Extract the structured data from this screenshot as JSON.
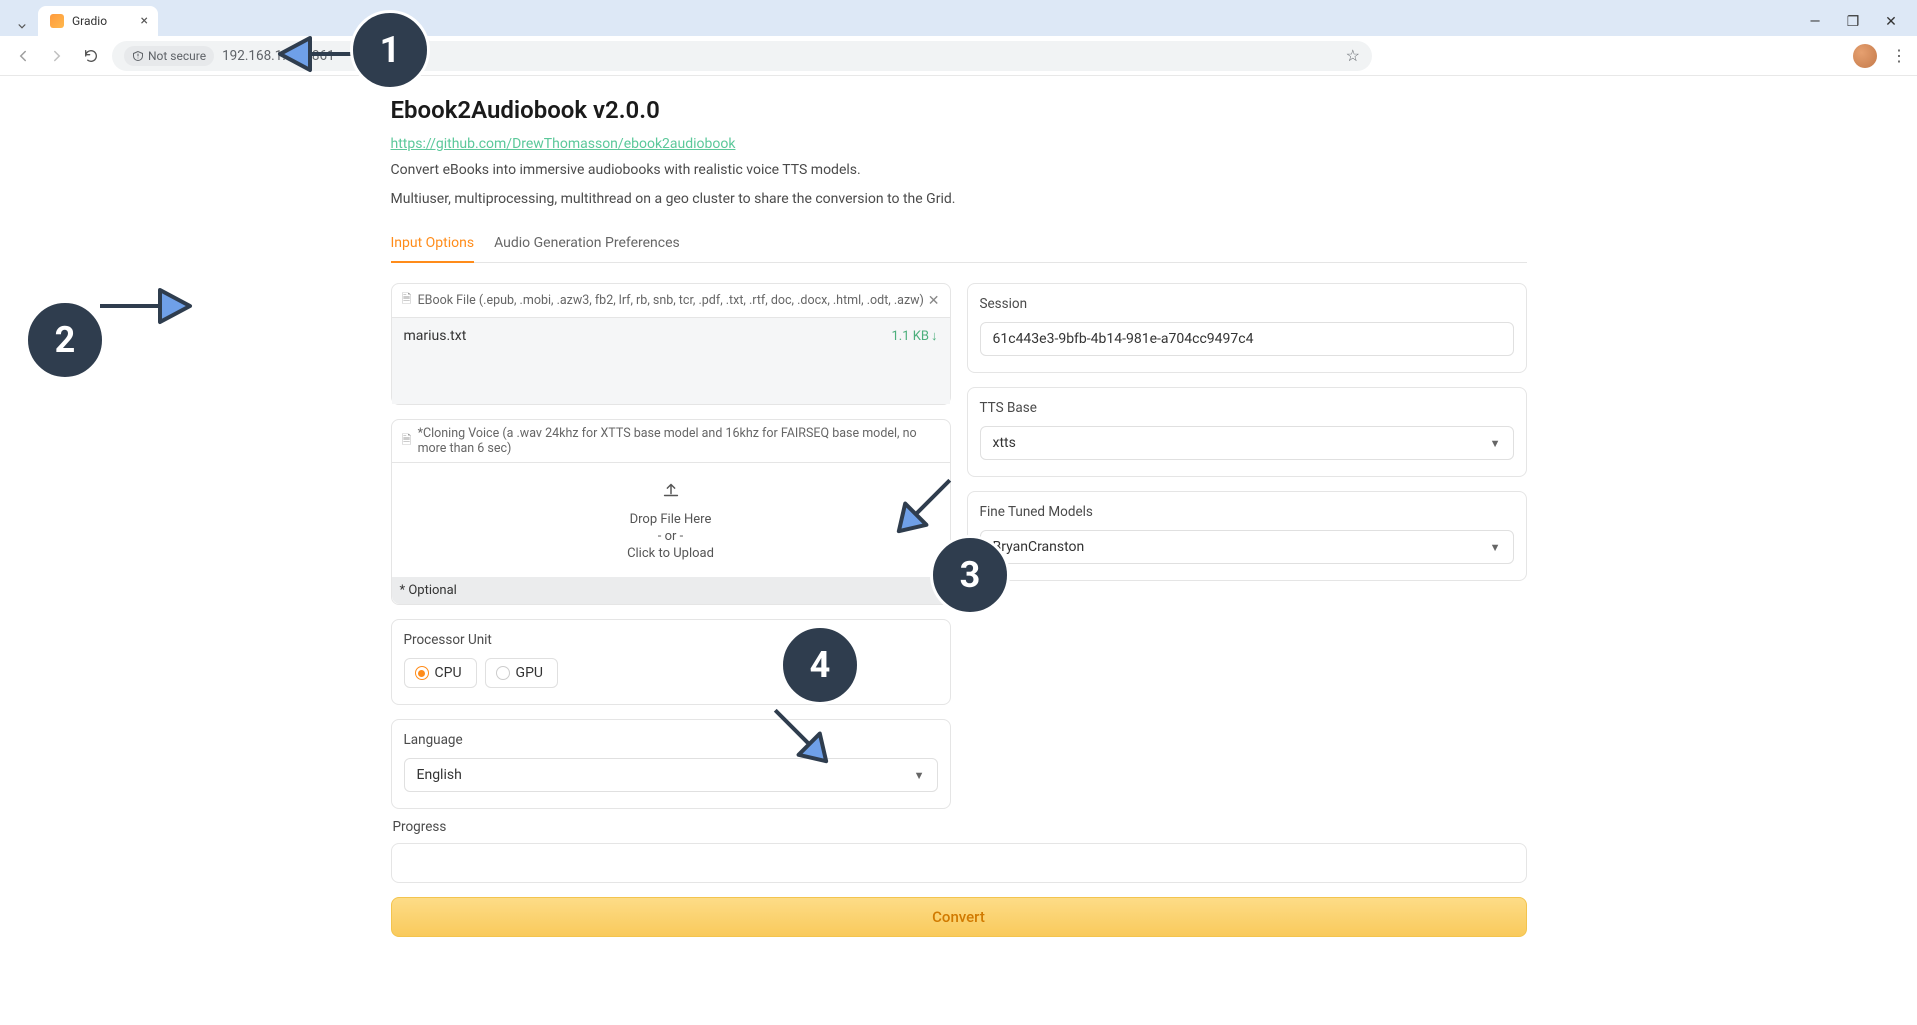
{
  "browser": {
    "tab_title": "Gradio",
    "not_secure": "Not secure",
    "url": "192.168.1.18:7861"
  },
  "page": {
    "title": "Ebook2Audiobook v2.0.0",
    "repo_url": "https://github.com/DrewThomasson/ebook2audiobook",
    "desc1": "Convert eBooks into immersive audiobooks with realistic voice TTS models.",
    "desc2": "Multiuser, multiprocessing, multithread on a geo cluster to share the conversion to the Grid."
  },
  "tabs": {
    "t1": "Input Options",
    "t2": "Audio Generation Preferences"
  },
  "ebook": {
    "label": "EBook File (.epub, .mobi, .azw3, fb2, lrf, rb, snb, tcr, .pdf, .txt, .rtf, doc, .docx, .html, .odt, .azw)",
    "file_name": "marius.txt",
    "file_size": "1.1 KB"
  },
  "voice": {
    "label": "*Cloning Voice (a .wav 24khz for XTTS base model and 16khz for FAIRSEQ base model, no more than 6 sec)",
    "drop": "Drop File Here",
    "or": "- or -",
    "click": "Click to Upload",
    "optional": "* Optional"
  },
  "proc": {
    "label": "Processor Unit",
    "cpu": "CPU",
    "gpu": "GPU"
  },
  "lang": {
    "label": "Language",
    "value": "English"
  },
  "session": {
    "label": "Session",
    "value": "61c443e3-9bfb-4b14-981e-a704cc9497c4"
  },
  "tts": {
    "label": "TTS Base",
    "value": "xtts"
  },
  "model": {
    "label": "Fine Tuned Models",
    "value": "BryanCranston"
  },
  "progress": {
    "label": "Progress"
  },
  "convert": {
    "label": "Convert"
  },
  "anno": {
    "n1": "1",
    "n2": "2",
    "n3": "3",
    "n4": "4"
  }
}
